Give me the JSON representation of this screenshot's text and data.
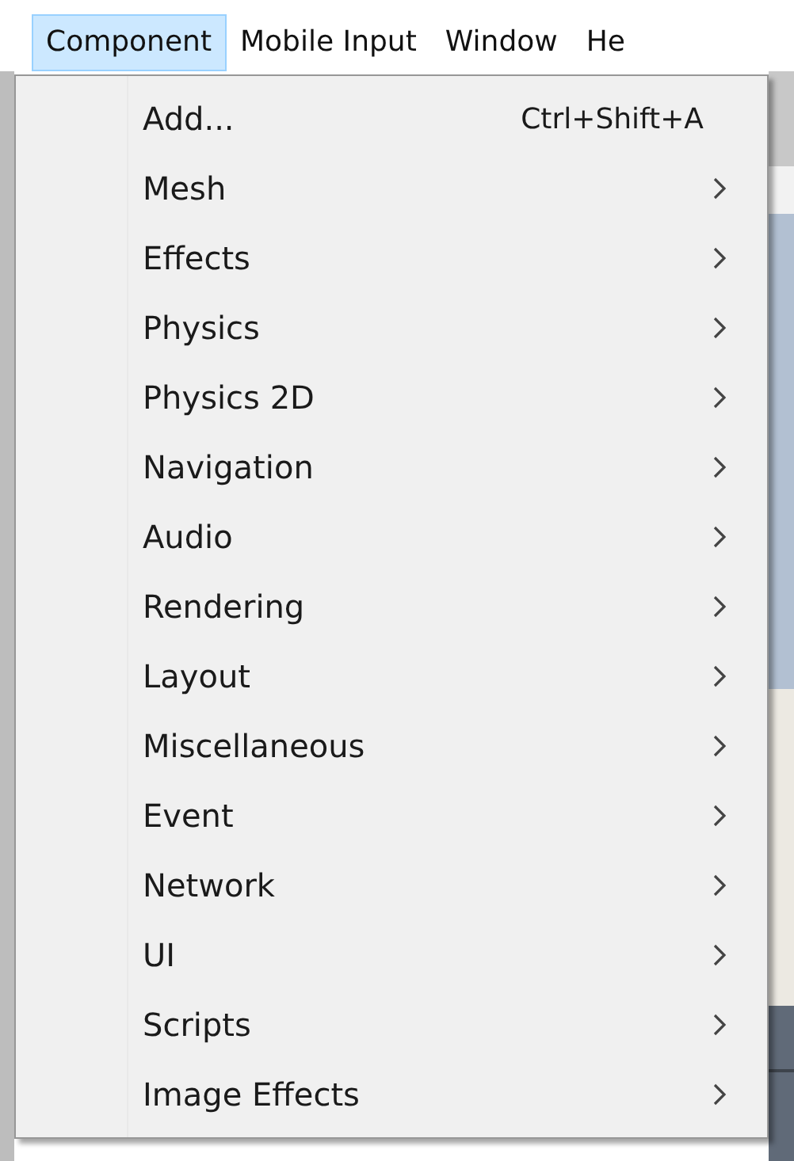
{
  "menu_bar": [
    {
      "label": "Component",
      "selected": true
    },
    {
      "label": "Mobile Input",
      "selected": false
    },
    {
      "label": "Window",
      "selected": false
    },
    {
      "label": "He",
      "selected": false
    }
  ],
  "menu": {
    "items": [
      {
        "label": "Add...",
        "shortcut": "Ctrl+Shift+A",
        "submenu": false
      },
      {
        "label": "Mesh",
        "submenu": true
      },
      {
        "label": "Effects",
        "submenu": true
      },
      {
        "label": "Physics",
        "submenu": true
      },
      {
        "label": "Physics 2D",
        "submenu": true
      },
      {
        "label": "Navigation",
        "submenu": true
      },
      {
        "label": "Audio",
        "submenu": true
      },
      {
        "label": "Rendering",
        "submenu": true
      },
      {
        "label": "Layout",
        "submenu": true
      },
      {
        "label": "Miscellaneous",
        "submenu": true
      },
      {
        "label": "Event",
        "submenu": true
      },
      {
        "label": "Network",
        "submenu": true
      },
      {
        "label": "UI",
        "submenu": true
      },
      {
        "label": "Scripts",
        "submenu": true
      },
      {
        "label": "Image Effects",
        "submenu": true
      }
    ]
  }
}
